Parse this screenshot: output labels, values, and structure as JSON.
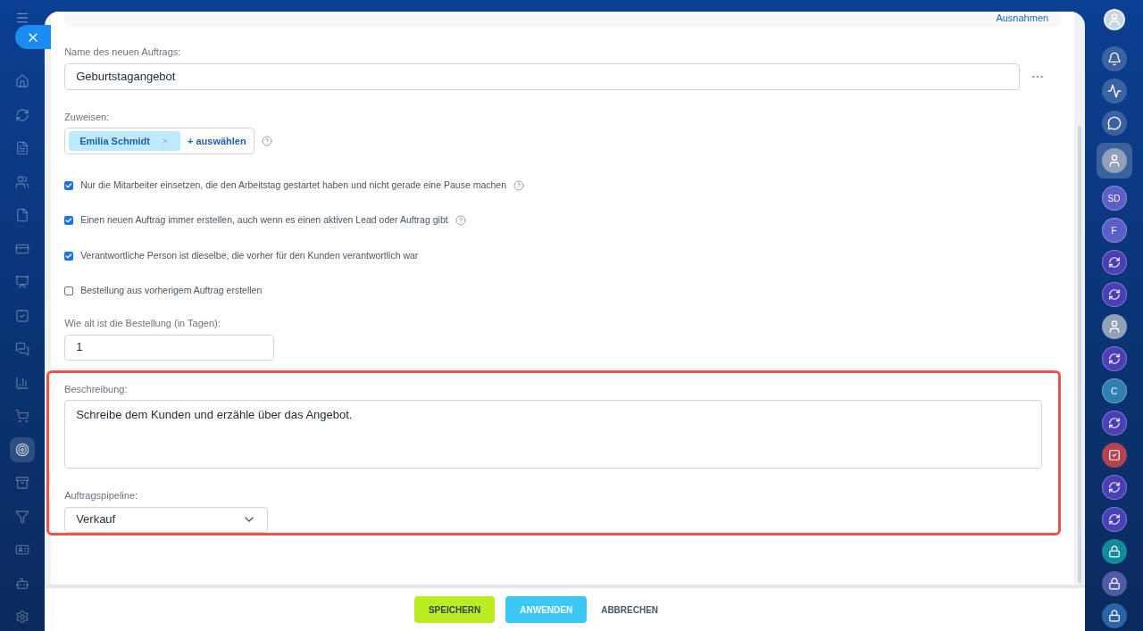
{
  "top_link": "Ausnahmen",
  "left_nav": [
    {
      "selected": false
    },
    {
      "selected": false
    },
    {
      "selected": false
    },
    {
      "selected": false
    },
    {
      "selected": false
    },
    {
      "selected": false
    },
    {
      "selected": false
    },
    {
      "selected": false
    },
    {
      "selected": false
    },
    {
      "selected": false
    },
    {
      "selected": false
    },
    {
      "selected": true
    },
    {
      "selected": false
    },
    {
      "selected": false
    },
    {
      "selected": false
    },
    {
      "selected": false
    },
    {
      "selected": false
    }
  ],
  "right_bar": [
    {
      "kind": "bell"
    },
    {
      "kind": "pulse"
    },
    {
      "kind": "chat"
    },
    {
      "kind": "avatar",
      "selected": true
    },
    {
      "kind": "initials",
      "text": "SD",
      "color": "#5b5fc7"
    },
    {
      "kind": "initials",
      "text": "F",
      "color": "#5b5fc7"
    },
    {
      "kind": "channel"
    },
    {
      "kind": "channel"
    },
    {
      "kind": "avatar",
      "selected": false
    },
    {
      "kind": "channel"
    },
    {
      "kind": "initials",
      "text": "C",
      "color": "#2f7fb0"
    },
    {
      "kind": "channel"
    },
    {
      "kind": "task"
    },
    {
      "kind": "channel"
    },
    {
      "kind": "channel"
    },
    {
      "kind": "lock",
      "color": "#138a9a"
    },
    {
      "kind": "lock",
      "color": "#4f5aa8"
    },
    {
      "kind": "lock",
      "color": "#2b63a8"
    }
  ],
  "name_field": {
    "label": "Name des neuen Auftrags:",
    "value": "Geburtstagangebot"
  },
  "assign": {
    "label": "Zuweisen:",
    "tags": [
      "Emilia Schmidt"
    ],
    "add": "+ auswählen"
  },
  "checkboxes": [
    {
      "label": "Nur die Mitarbeiter einsetzen, die den Arbeitstag gestartet haben und nicht gerade eine Pause machen",
      "checked": true,
      "help": true
    },
    {
      "label": "Einen neuen Auftrag immer erstellen, auch wenn es einen aktiven Lead oder Auftrag gibt",
      "checked": true,
      "help": true
    },
    {
      "label": "Verantwortliche Person ist dieselbe, die vorher für den Kunden verantwortlich war",
      "checked": true,
      "help": false
    },
    {
      "label": "Bestellung aus vorherigem Auftrag erstellen",
      "checked": false,
      "help": false
    }
  ],
  "days_field": {
    "label": "Wie alt ist die Bestellung (in Tagen):",
    "value": "1"
  },
  "description": {
    "label": "Beschreibung:",
    "value": "Schreibe dem Kunden und erzähle über das Angebot."
  },
  "pipeline": {
    "label": "Auftragspipeline:",
    "value": "Verkauf"
  },
  "buttons": [
    {
      "kind": "save",
      "label": "SPEICHERN"
    },
    {
      "kind": "apply",
      "label": "ANWENDEN"
    },
    {
      "kind": "cancel",
      "label": "ABBRECHEN"
    }
  ]
}
